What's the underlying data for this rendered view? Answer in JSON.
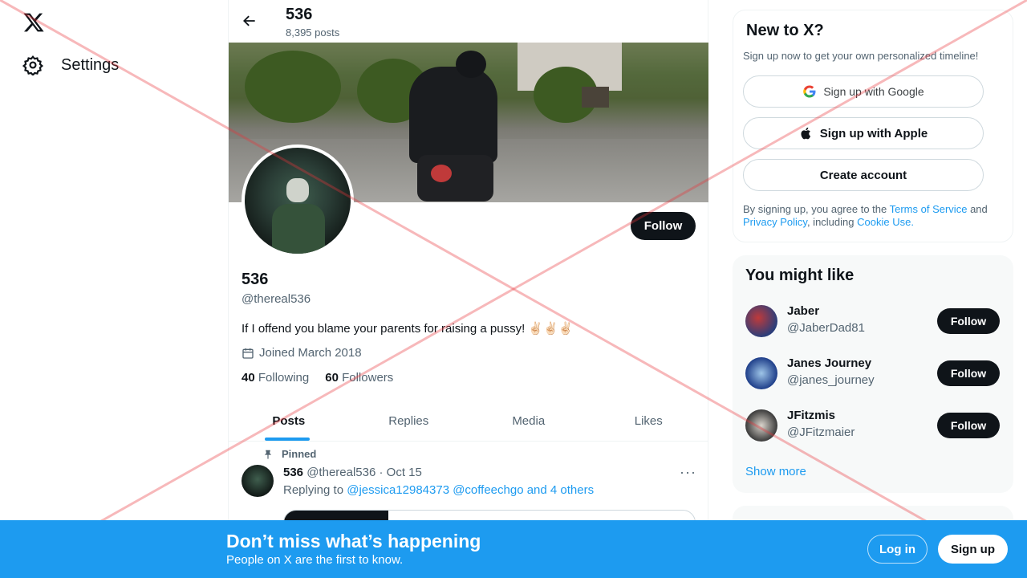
{
  "nav": {
    "settings_label": "Settings"
  },
  "header": {
    "title": "536",
    "posts_count": "8,395 posts"
  },
  "profile": {
    "name": "536",
    "handle": "@thereal536",
    "bio": "If I offend you blame your parents for raising a pussy! ✌🏻✌🏻✌🏻",
    "joined": "Joined March 2018",
    "following_count": "40",
    "following_label": "Following",
    "followers_count": "60",
    "followers_label": "Followers",
    "follow_label": "Follow"
  },
  "tabs": [
    {
      "label": "Posts"
    },
    {
      "label": "Replies"
    },
    {
      "label": "Media"
    },
    {
      "label": "Likes"
    }
  ],
  "post": {
    "pinned_label": "Pinned",
    "author": "536",
    "handle": "@thereal536",
    "date": "· Oct 15",
    "more": "···",
    "replying_prefix": "Replying to",
    "replying_to": "@jessica12984373 @coffeechgo and 4 others"
  },
  "signup_box": {
    "title": "New to X?",
    "subtitle": "Sign up now to get your own personalized timeline!",
    "google": "Sign up with Google",
    "apple": "Sign up with Apple",
    "create": "Create account",
    "terms_prefix": "By signing up, you agree to the",
    "terms_link": "Terms of Service",
    "and": "and",
    "privacy_link": "Privacy Policy",
    "including": ", including",
    "cookie_link": "Cookie Use."
  },
  "suggestions": {
    "title": "You might like",
    "items": [
      {
        "name": "Jaber",
        "handle": "@JaberDad81",
        "follow": "Follow"
      },
      {
        "name": "Janes Journey",
        "handle": "@janes_journey",
        "follow": "Follow"
      },
      {
        "name": "JFitzmis",
        "handle": "@JFitzmaier",
        "follow": "Follow"
      }
    ],
    "show_more": "Show more"
  },
  "bottom_bar": {
    "headline": "Don’t miss what’s happening",
    "subline": "People on X are the first to know.",
    "login": "Log in",
    "signup": "Sign up"
  },
  "colors": {
    "accent": "#1d9bf0",
    "dark": "#0f1419",
    "muted": "#536471"
  }
}
